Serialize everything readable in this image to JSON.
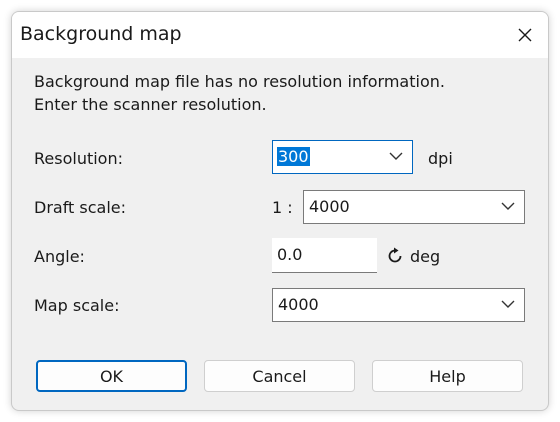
{
  "window": {
    "title": "Background map",
    "close_icon": "close-icon"
  },
  "message": {
    "line1": "Background map file has no resolution information.",
    "line2": "Enter the scanner resolution."
  },
  "resolution": {
    "label": "Resolution:",
    "value": "300",
    "unit": "dpi"
  },
  "draft_scale": {
    "label": "Draft scale:",
    "prefix": "1 :",
    "value": "4000"
  },
  "angle": {
    "label": "Angle:",
    "value": "0.0",
    "icon": "rotate-clockwise-icon",
    "unit": "deg"
  },
  "map_scale": {
    "label": "Map scale:",
    "value": "4000"
  },
  "buttons": {
    "ok": "OK",
    "cancel": "Cancel",
    "help": "Help"
  },
  "colors": {
    "accent": "#0067c0",
    "selection": "#0078d7",
    "background": "#f0f0f0"
  }
}
